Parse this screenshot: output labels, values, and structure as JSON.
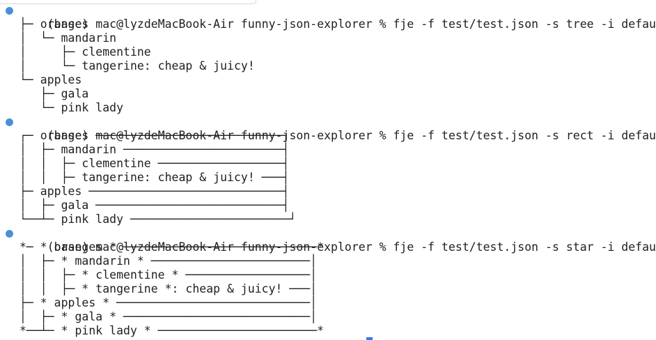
{
  "prompt": {
    "env": "(base)",
    "host": "mac@lyzdeMacBook-Air",
    "dir": "funny-json-explorer",
    "symbol": "%"
  },
  "commands": [
    "fje -f test/test.json -s tree -i default",
    "fje -f test/test.json -s rect -i default",
    "fje -f test/test.json -s star -i default"
  ],
  "outputs": {
    "tree": [
      "├─ oranges",
      "│  └─ mandarin",
      "│     ├─ clementine",
      "│     └─ tangerine: cheap & juicy!",
      "└─ apples",
      "   ├─ gala",
      "   └─ pink lady"
    ],
    "rect": [
      "┌─ oranges ───────────────────────────┐",
      "│  ├─ mandarin ───────────────────────┤",
      "│  │  ├─ clementine ──────────────────┤",
      "│  │  ├─ tangerine: cheap & juicy! ───┤",
      "├─ apples ────────────────────────────┤",
      "│  ├─ gala ───────────────────────────┤",
      "└──┴─ pink lady ───────────────────────┘"
    ],
    "star": [
      "*─ * oranges * ────────────────────────────*",
      "│  ├─ * mandarin * ───────────────────────│",
      "│  │  ├─ * clementine * ──────────────────│",
      "│  │  ├─ * tangerine *: cheap & juicy! ───│",
      "├─ * apples * ────────────────────────────│",
      "│  ├─ * gala * ───────────────────────────│",
      "*──┴─ * pink lady * ───────────────────────*"
    ]
  }
}
